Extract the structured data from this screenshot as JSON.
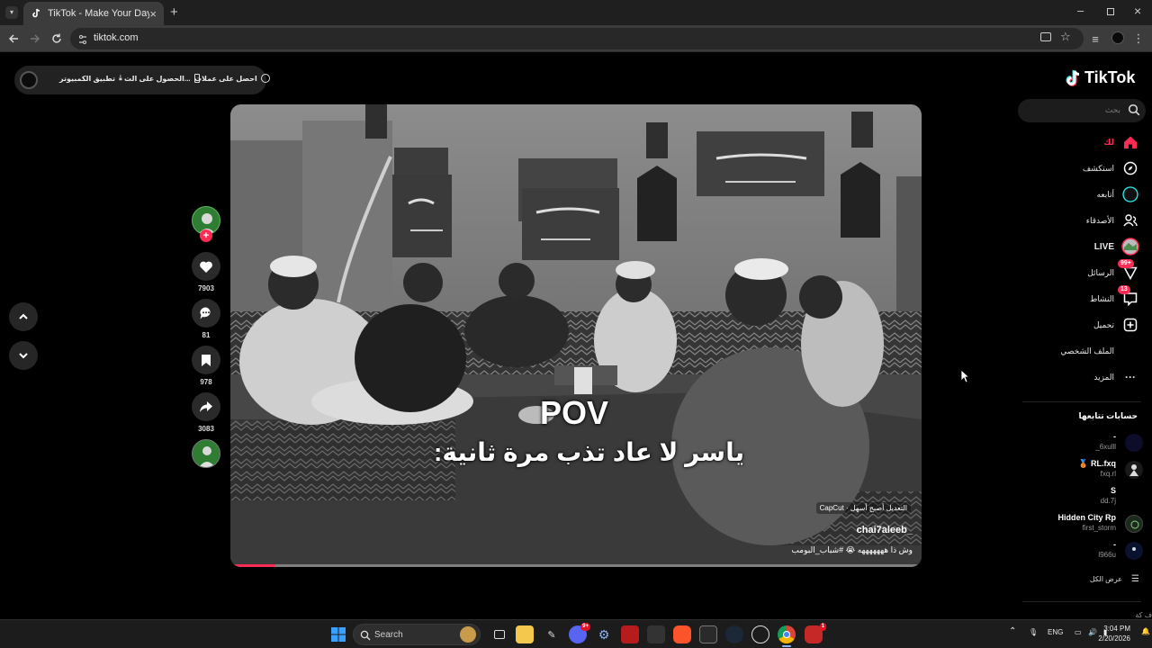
{
  "browser": {
    "tab_title": "TikTok - Make Your Day",
    "url": "tiktok.com",
    "window_controls": [
      "minimize",
      "restore",
      "close"
    ]
  },
  "top_pill": {
    "desktop_app": "تطبيق الكمبيوتر",
    "get_app": "الحصول على الت...",
    "get_coins": "احصل على عملات"
  },
  "video": {
    "pov_text": "POV",
    "caption": "ياسر لا عاد تذب مرة ثانية:",
    "capcut_label": "CapCut · التعديل أصبح أسهل",
    "author": "chai7aleeb_",
    "description": "وش ذا هههههههه 😭 #شباب_البومب",
    "progress": 0.065
  },
  "actions": {
    "likes": "7903",
    "comments": "81",
    "saves": "978",
    "shares": "3083"
  },
  "sidebar": {
    "logo": "TikTok",
    "search_placeholder": "بحث",
    "nav": [
      {
        "label": "لك",
        "icon": "home-icon",
        "active": true
      },
      {
        "label": "استكشف",
        "icon": "compass-icon"
      },
      {
        "label": "أتابعه",
        "icon": "following-icon"
      },
      {
        "label": "الأصدقاء",
        "icon": "friends-icon"
      },
      {
        "label": "LIVE",
        "icon": "live-icon"
      },
      {
        "label": "الرسائل",
        "icon": "messages-icon",
        "badge": "99+"
      },
      {
        "label": "النشاط",
        "icon": "activity-icon",
        "badge": "13"
      },
      {
        "label": "تحميل",
        "icon": "upload-icon"
      },
      {
        "label": "الملف الشخصي",
        "icon": "profile-icon"
      },
      {
        "label": "المزيد",
        "icon": "more-icon"
      }
    ],
    "following_title": "حسابات تتابعها",
    "accounts": [
      {
        "name": "-",
        "handle": "_6xulll"
      },
      {
        "name": "🥉 RL.fxq",
        "handle": "fxq.rl"
      },
      {
        "name": "S",
        "handle": "dd.7j"
      },
      {
        "name": "Hidden City Rp",
        "handle": "first_storm"
      },
      {
        "name": "-",
        "handle": "l966u"
      }
    ],
    "see_all": "عرض الكل",
    "more_cut": "ف كة"
  },
  "taskbar": {
    "search_label": "Search",
    "discord_badge": "9+",
    "brave_badge": "1",
    "lang": "ENG",
    "time": "3:04 PM",
    "date": "2/20/2026"
  },
  "colors": {
    "accent": "#fe2c55",
    "live_ring": "#25f4ee"
  }
}
